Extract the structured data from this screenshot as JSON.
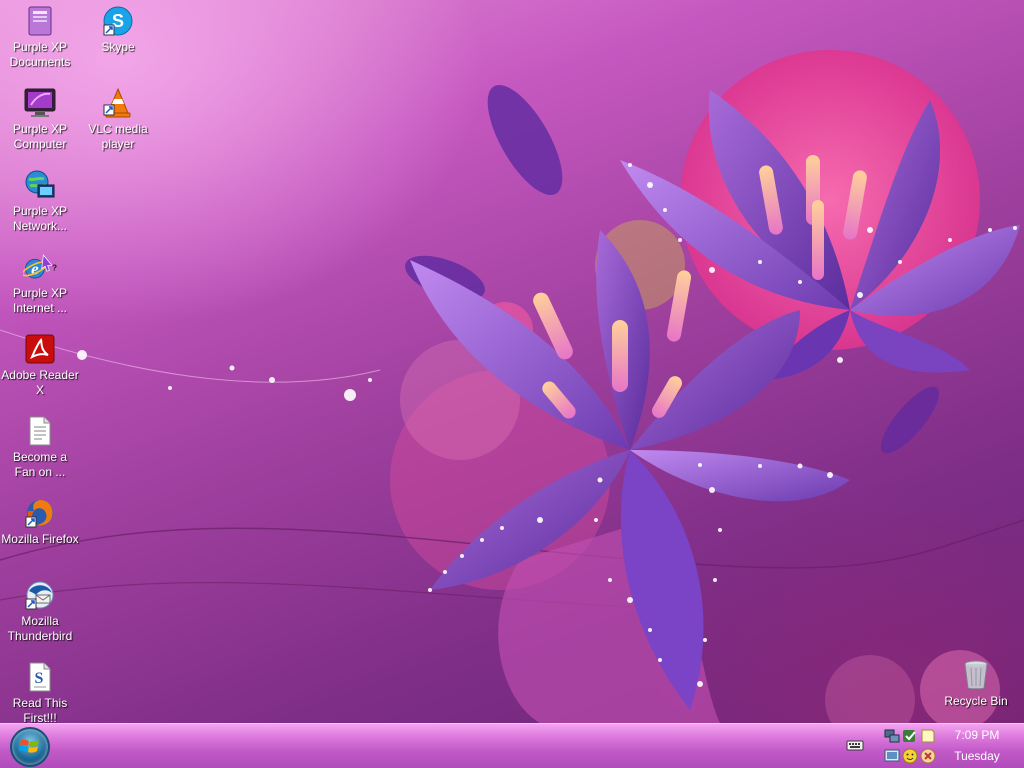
{
  "desktop": {
    "icons": [
      {
        "id": "purple-xp-documents",
        "label": "Purple XP Documents",
        "icon": "documents-folder-icon"
      },
      {
        "id": "skype",
        "label": "Skype",
        "icon": "skype-icon"
      },
      {
        "id": "purple-xp-computer",
        "label": "Purple XP Computer",
        "icon": "computer-monitor-icon"
      },
      {
        "id": "vlc-media-player",
        "label": "VLC media player",
        "icon": "vlc-cone-icon"
      },
      {
        "id": "purple-xp-network",
        "label": "Purple XP Network...",
        "icon": "network-globe-icon"
      },
      {
        "id": "purple-xp-internet",
        "label": "Purple XP Internet ...",
        "icon": "internet-explorer-icon"
      },
      {
        "id": "adobe-reader-x",
        "label": "Adobe Reader X",
        "icon": "adobe-reader-icon"
      },
      {
        "id": "become-a-fan",
        "label": "Become a Fan on ...",
        "icon": "text-document-icon"
      },
      {
        "id": "mozilla-firefox",
        "label": "Mozilla Firefox",
        "icon": "firefox-icon"
      },
      {
        "id": "mozilla-thunderbird",
        "label": "Mozilla Thunderbird",
        "icon": "thunderbird-icon"
      },
      {
        "id": "read-this-first",
        "label": "Read This First!!!",
        "icon": "readme-document-icon"
      },
      {
        "id": "recycle-bin",
        "label": "Recycle Bin",
        "icon": "recycle-bin-icon"
      }
    ]
  },
  "taskbar": {
    "start_icon": "windows-logo-icon",
    "tray": {
      "keyboard_icon": "keyboard-icon",
      "icons": [
        "network-icon",
        "security-check-icon",
        "note-icon",
        "display-icon",
        "smiley-icon",
        "close-circle-icon"
      ]
    },
    "clock": {
      "time": "7:09 PM",
      "day": "Tuesday"
    }
  },
  "colors": {
    "taskbar_top": "#f3a4f0",
    "taskbar_bottom": "#b04cbb",
    "desktop_accent": "#c558c0"
  }
}
